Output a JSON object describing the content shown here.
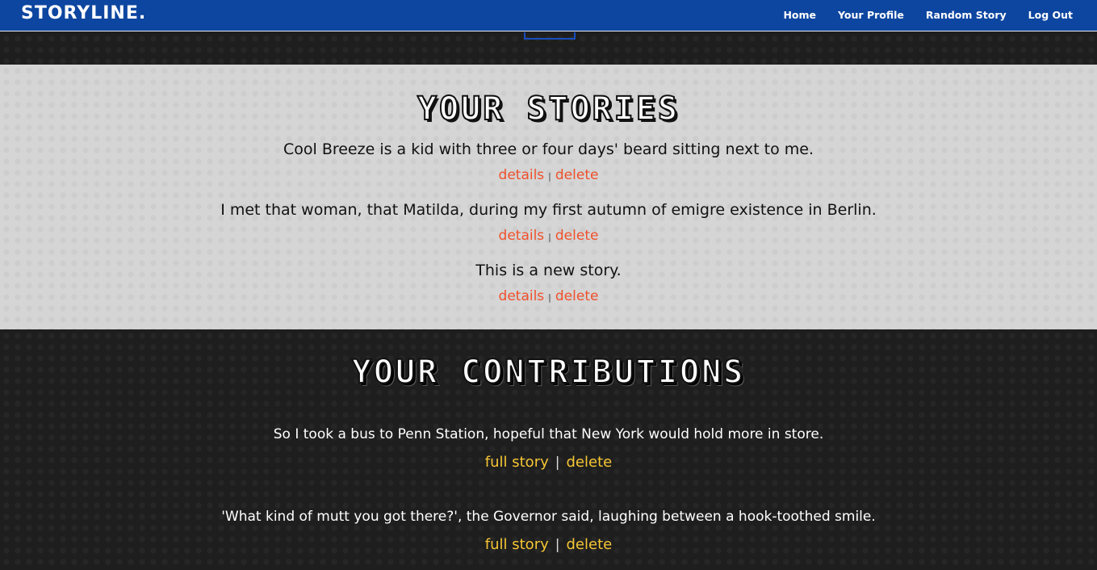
{
  "navbar": {
    "brand": "STORYLINE.",
    "links": [
      "Home",
      "Your Profile",
      "Random Story",
      "Log Out"
    ]
  },
  "stories": {
    "title": "YOUR STORIES",
    "items": [
      {
        "text": "Cool Breeze is a kid with three or four days' beard sitting next to me.",
        "details": "details",
        "delete": "delete"
      },
      {
        "text": "I met that woman, that Matilda, during my first autumn of emigre existence in Berlin.",
        "details": "details",
        "delete": "delete"
      },
      {
        "text": "This is a new story.",
        "details": "details",
        "delete": "delete"
      }
    ],
    "separator": "|"
  },
  "contributions": {
    "title": "YOUR CONTRIBUTIONS",
    "items": [
      {
        "text": "So I took a bus to Penn Station, hopeful that New York would hold more in store.",
        "full_story": "full story",
        "delete": "delete"
      },
      {
        "text": "'What kind of mutt you got there?', the Governor said, laughing between a hook-toothed smile.",
        "full_story": "full story",
        "delete": "delete"
      }
    ],
    "separator": "|"
  },
  "colors": {
    "navbar": "#0d46a0",
    "light_link": "#f0502a",
    "dark_link": "#f5c634"
  }
}
